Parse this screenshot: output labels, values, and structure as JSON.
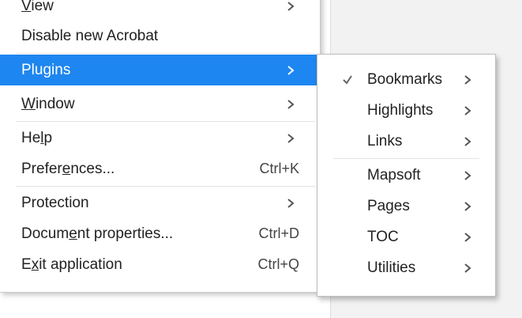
{
  "main_menu": {
    "items": [
      {
        "label": "View",
        "mnemonic_index": 0,
        "has_submenu": true,
        "shortcut": ""
      },
      {
        "label": "Disable new Acrobat",
        "has_submenu": false,
        "shortcut": ""
      },
      {
        "label": "Plugins",
        "has_submenu": true,
        "shortcut": "",
        "selected": true
      },
      {
        "label": "Window",
        "mnemonic_index": 0,
        "has_submenu": true,
        "shortcut": ""
      },
      {
        "label": "Help",
        "mnemonic_index": 2,
        "has_submenu": true,
        "shortcut": ""
      },
      {
        "label": "Preferences...",
        "mnemonic_index": 6,
        "has_submenu": false,
        "shortcut": "Ctrl+K"
      },
      {
        "label": "Protection",
        "has_submenu": true,
        "shortcut": ""
      },
      {
        "label": "Document properties...",
        "mnemonic_index": 5,
        "has_submenu": false,
        "shortcut": "Ctrl+D"
      },
      {
        "label": "Exit application",
        "mnemonic_index": 1,
        "has_submenu": false,
        "shortcut": "Ctrl+Q"
      }
    ]
  },
  "plugins_submenu": {
    "items": [
      {
        "label": "Bookmarks",
        "checked": true
      },
      {
        "label": "Highlights",
        "checked": false
      },
      {
        "label": "Links",
        "checked": false
      },
      {
        "label": "Mapsoft",
        "checked": false
      },
      {
        "label": "Pages",
        "checked": false
      },
      {
        "label": "TOC",
        "checked": false
      },
      {
        "label": "Utilities",
        "checked": false
      }
    ]
  },
  "colors": {
    "selection": "#1e86f0",
    "menu_background": "#ffffff",
    "page_background": "#f2f2f2"
  },
  "icons": {
    "submenu_arrow": "chevron-right-icon",
    "checkmark": "checkmark-icon"
  }
}
